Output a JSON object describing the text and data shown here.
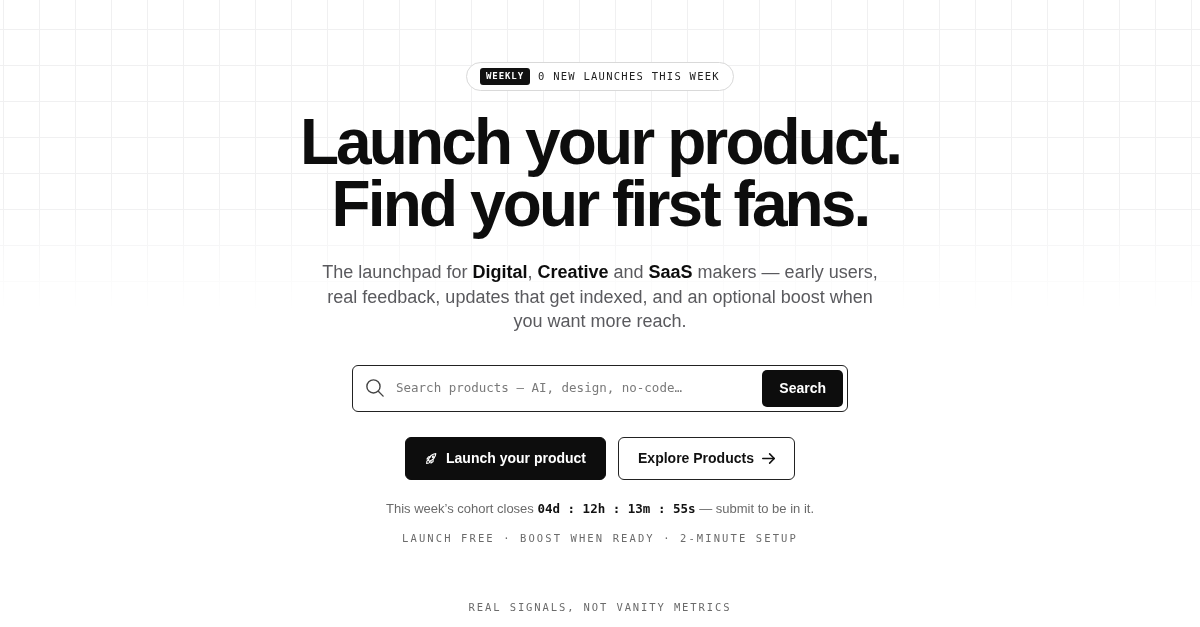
{
  "badge": {
    "tag": "WEEKLY",
    "text": "0 NEW LAUNCHES THIS WEEK"
  },
  "headline": [
    "Launch your product.",
    "Find your first fans."
  ],
  "subtitle": "The launchpad for **Digital**, **Creative** and **SaaS** makers — early users, real feedback, updates that get indexed, and an optional boost when you want more reach.",
  "search": {
    "placeholder": "Search products — AI, design, no-code…",
    "button": "Search"
  },
  "actions": [
    {
      "kind": "primary",
      "label": "Launch your product"
    },
    {
      "kind": "secondary",
      "label": "Explore Products"
    }
  ],
  "countdown": "This week’s cohort closes **04d : 12h : 13m : 55s** — submit to be in it.",
  "perks": "LAUNCH FREE · BOOST WHEN READY · 2-MINUTE SETUP",
  "section_label": "REAL SIGNALS, NOT VANITY METRICS"
}
